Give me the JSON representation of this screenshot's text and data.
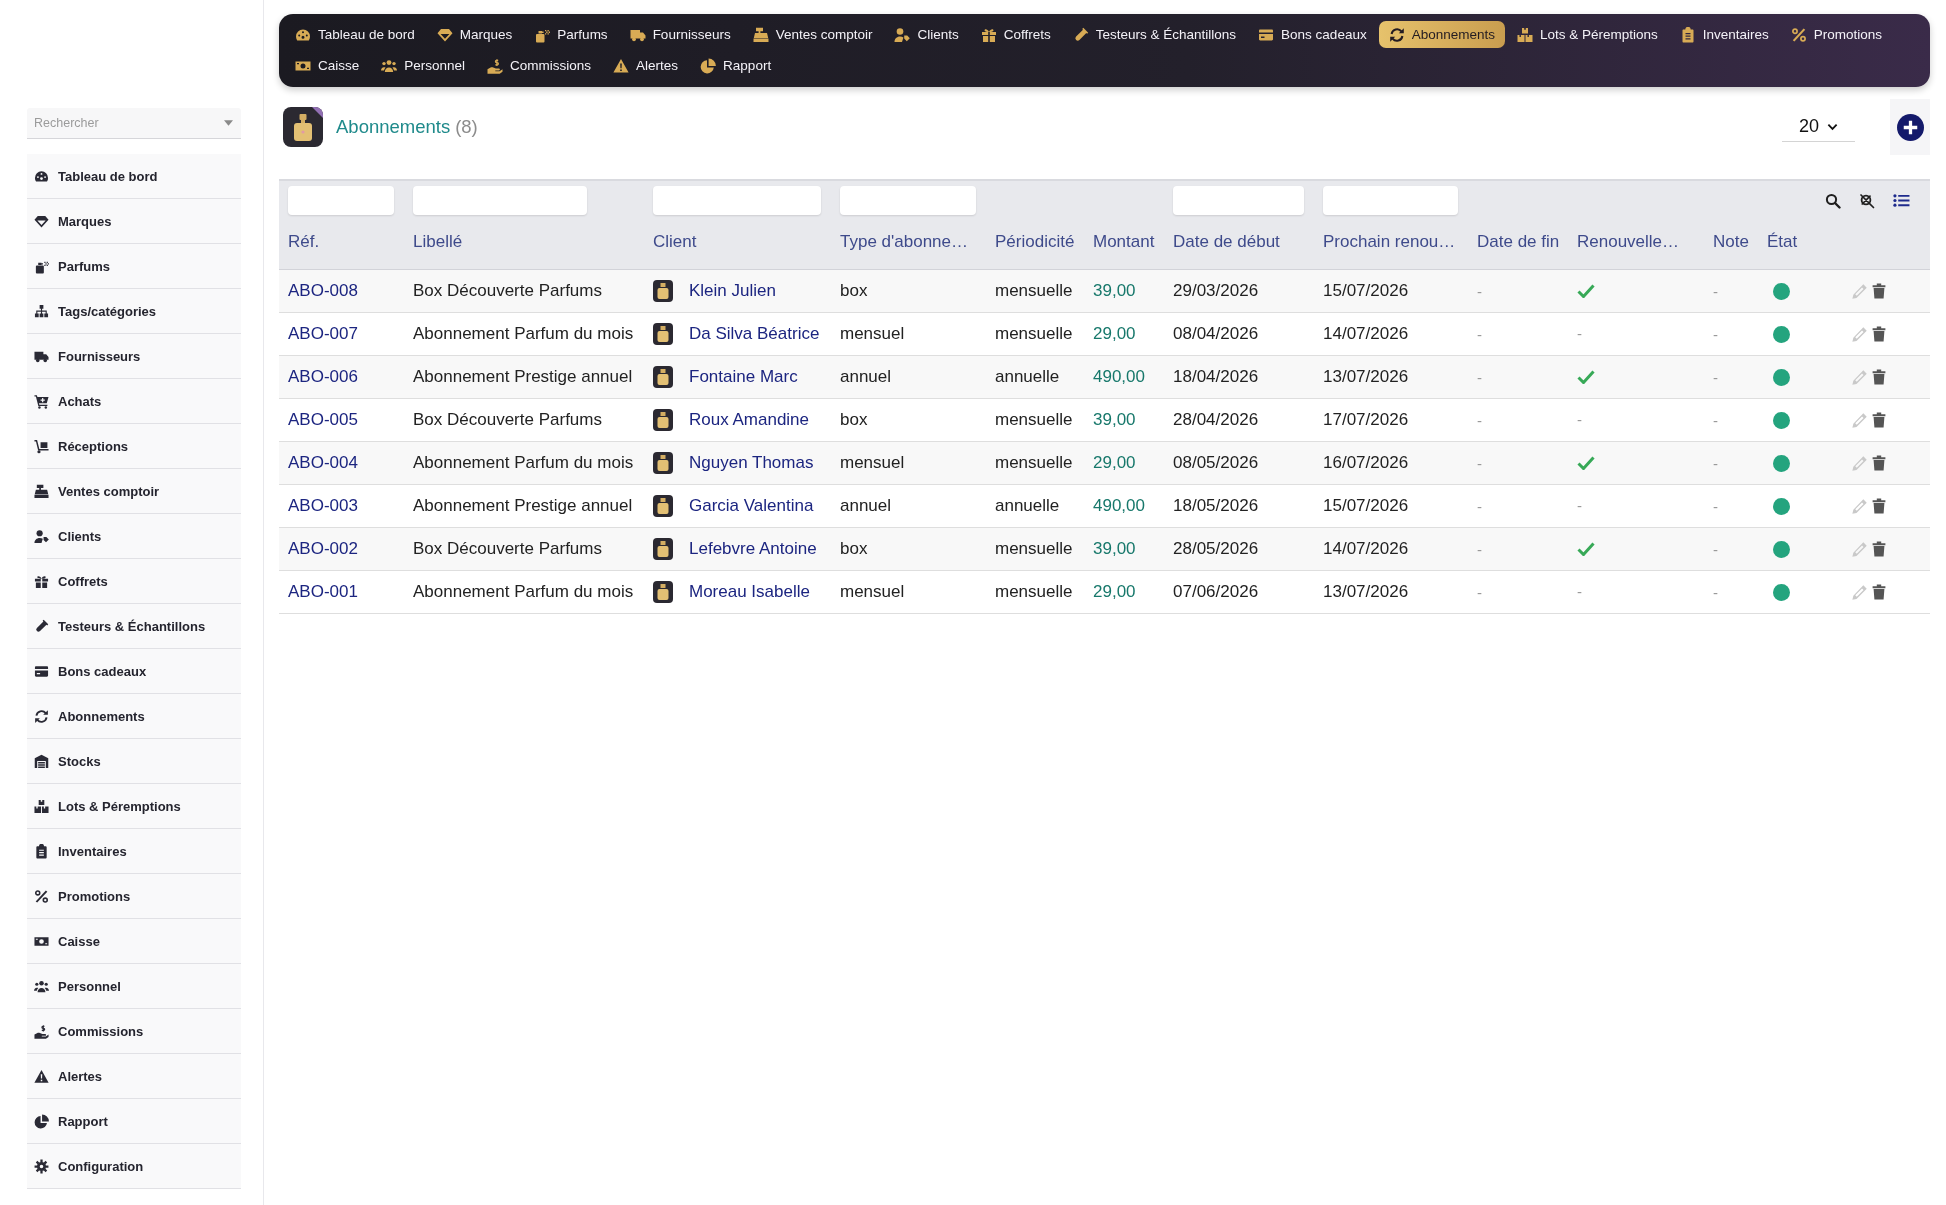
{
  "nav": {
    "items": [
      {
        "label": "Tableau de bord",
        "selected": false
      },
      {
        "label": "Marques",
        "selected": false
      },
      {
        "label": "Parfums",
        "selected": false
      },
      {
        "label": "Fournisseurs",
        "selected": false
      },
      {
        "label": "Ventes comptoir",
        "selected": false
      },
      {
        "label": "Clients",
        "selected": false
      },
      {
        "label": "Coffrets",
        "selected": false
      },
      {
        "label": "Testeurs & Échantillons",
        "selected": false
      },
      {
        "label": "Bons cadeaux",
        "selected": false
      },
      {
        "label": "Abonnements",
        "selected": true
      },
      {
        "label": "Lots & Péremptions",
        "selected": false
      },
      {
        "label": "Inventaires",
        "selected": false
      },
      {
        "label": "Promotions",
        "selected": false
      },
      {
        "label": "Caisse",
        "selected": false
      },
      {
        "label": "Personnel",
        "selected": false
      },
      {
        "label": "Commissions",
        "selected": false
      },
      {
        "label": "Alertes",
        "selected": false
      },
      {
        "label": "Rapport",
        "selected": false
      }
    ]
  },
  "sidebar": {
    "search": {
      "placeholder": "Rechercher"
    },
    "items": [
      "Tableau de bord",
      "Marques",
      "Parfums",
      "Tags/catégories",
      "Fournisseurs",
      "Achats",
      "Réceptions",
      "Ventes comptoir",
      "Clients",
      "Coffrets",
      "Testeurs & Échantillons",
      "Bons cadeaux",
      "Abonnements",
      "Stocks",
      "Lots & Péremptions",
      "Inventaires",
      "Promotions",
      "Caisse",
      "Personnel",
      "Commissions",
      "Alertes",
      "Rapport",
      "Configuration"
    ]
  },
  "page": {
    "title": "Abonnements",
    "count": "(8)",
    "page_size": "20"
  },
  "table": {
    "columns": [
      {
        "label": "Réf.",
        "filter": true
      },
      {
        "label": "Libellé",
        "filter": true
      },
      {
        "label": "Client",
        "filter": true
      },
      {
        "label": "Type d'abonne…",
        "filter": true
      },
      {
        "label": "Périodicité",
        "filter": false
      },
      {
        "label": "Montant",
        "filter": false
      },
      {
        "label": "Date de début",
        "filter": true
      },
      {
        "label": "Prochain renou…",
        "filter": true
      },
      {
        "label": "Date de fin",
        "filter": false
      },
      {
        "label": "Renouvelle…",
        "filter": false
      },
      {
        "label": "Note",
        "filter": false
      },
      {
        "label": "État",
        "filter": false
      }
    ],
    "rows": [
      {
        "ref": "ABO-008",
        "label": "Box Découverte Parfums",
        "client": "Klein Julien",
        "type": "box",
        "periodicity": "mensuelle",
        "amount": "39,00",
        "start_date": "29/03/2026",
        "next_renewal": "15/07/2026",
        "end_date": "-",
        "auto_renew": true,
        "note": "-",
        "active": true
      },
      {
        "ref": "ABO-007",
        "label": "Abonnement Parfum du mois",
        "client": "Da Silva Béatrice",
        "type": "mensuel",
        "periodicity": "mensuelle",
        "amount": "29,00",
        "start_date": "08/04/2026",
        "next_renewal": "14/07/2026",
        "end_date": "-",
        "auto_renew": false,
        "auto_renew_text": "-",
        "note": "-",
        "active": true
      },
      {
        "ref": "ABO-006",
        "label": "Abonnement Prestige annuel",
        "client": "Fontaine Marc",
        "type": "annuel",
        "periodicity": "annuelle",
        "amount": "490,00",
        "start_date": "18/04/2026",
        "next_renewal": "13/07/2026",
        "end_date": "-",
        "auto_renew": true,
        "note": "-",
        "active": true
      },
      {
        "ref": "ABO-005",
        "label": "Box Découverte Parfums",
        "client": "Roux Amandine",
        "type": "box",
        "periodicity": "mensuelle",
        "amount": "39,00",
        "start_date": "28/04/2026",
        "next_renewal": "17/07/2026",
        "end_date": "-",
        "auto_renew": false,
        "auto_renew_text": "-",
        "note": "-",
        "active": true
      },
      {
        "ref": "ABO-004",
        "label": "Abonnement Parfum du mois",
        "client": "Nguyen Thomas",
        "type": "mensuel",
        "periodicity": "mensuelle",
        "amount": "29,00",
        "start_date": "08/05/2026",
        "next_renewal": "16/07/2026",
        "end_date": "-",
        "auto_renew": true,
        "note": "-",
        "active": true
      },
      {
        "ref": "ABO-003",
        "label": "Abonnement Prestige annuel",
        "client": "Garcia Valentina",
        "type": "annuel",
        "periodicity": "annuelle",
        "amount": "490,00",
        "start_date": "18/05/2026",
        "next_renewal": "15/07/2026",
        "end_date": "-",
        "auto_renew": false,
        "auto_renew_text": "-",
        "note": "-",
        "active": true
      },
      {
        "ref": "ABO-002",
        "label": "Box Découverte Parfums",
        "client": "Lefebvre Antoine",
        "type": "box",
        "periodicity": "mensuelle",
        "amount": "39,00",
        "start_date": "28/05/2026",
        "next_renewal": "14/07/2026",
        "end_date": "-",
        "auto_renew": true,
        "note": "-",
        "active": true
      },
      {
        "ref": "ABO-001",
        "label": "Abonnement Parfum du mois",
        "client": "Moreau Isabelle",
        "type": "mensuel",
        "periodicity": "mensuelle",
        "amount": "29,00",
        "start_date": "07/06/2026",
        "next_renewal": "13/07/2026",
        "end_date": "-",
        "auto_renew": false,
        "auto_renew_text": "-",
        "note": "-",
        "active": true
      }
    ]
  }
}
